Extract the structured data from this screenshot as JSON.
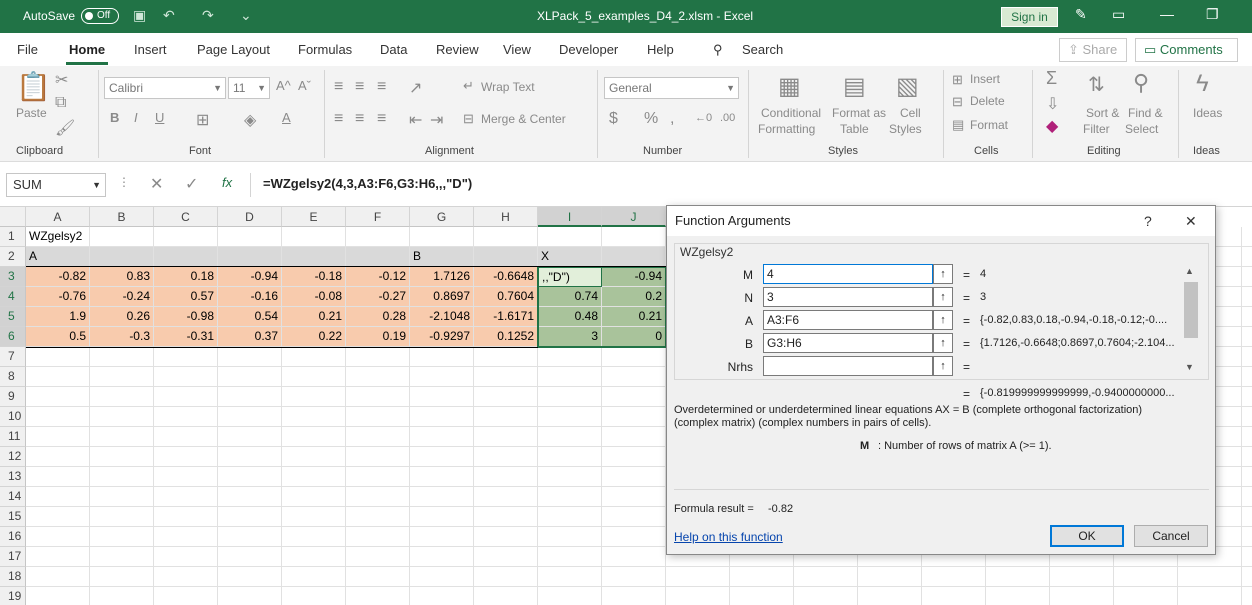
{
  "titlebar": {
    "autosave": "AutoSave",
    "toggle": "Off",
    "title": "XLPack_5_examples_D4_2.xlsm  -  Excel",
    "signin": "Sign in"
  },
  "menu": {
    "items": [
      "File",
      "Home",
      "Insert",
      "Page Layout",
      "Formulas",
      "Data",
      "Review",
      "View",
      "Developer",
      "Help"
    ],
    "search": "Search",
    "share": "Share",
    "comments": "Comments"
  },
  "ribbon": {
    "paste": "Paste",
    "font_name": "Calibri",
    "font_size": "11",
    "wrap_text": "Wrap Text",
    "merge_center": "Merge & Center",
    "number_format": "General",
    "cond_fmt1": "Conditional",
    "cond_fmt2": "Formatting",
    "fmt_table1": "Format as",
    "fmt_table2": "Table",
    "cell_styles1": "Cell",
    "cell_styles2": "Styles",
    "insert": "Insert",
    "delete": "Delete",
    "format": "Format",
    "sort1": "Sort &",
    "sort2": "Filter",
    "find1": "Find &",
    "find2": "Select",
    "ideas": "Ideas",
    "groups": {
      "clipboard": "Clipboard",
      "font": "Font",
      "alignment": "Alignment",
      "number": "Number",
      "styles": "Styles",
      "cells": "Cells",
      "editing": "Editing",
      "ideas": "Ideas"
    }
  },
  "formula_bar": {
    "name_box": "SUM",
    "formula": "=WZgelsy2(4,3,A3:F6,G3:H6,,,\"D\")"
  },
  "sheet": {
    "columns": [
      "A",
      "B",
      "C",
      "D",
      "E",
      "F",
      "G",
      "H",
      "I",
      "J"
    ],
    "rows": [
      "1",
      "2",
      "3",
      "4",
      "5",
      "6",
      "7",
      "8",
      "9",
      "10",
      "11",
      "12",
      "13",
      "14",
      "15",
      "16",
      "17",
      "18",
      "19"
    ],
    "a1": "WZgelsy2",
    "a2": "A",
    "g2": "B",
    "i2": "X",
    "i3": ",,\"D\")",
    "data": [
      [
        "-0.82",
        "0.83",
        "0.18",
        "-0.94",
        "-0.18",
        "-0.12",
        "1.7126",
        "-0.6648",
        "",
        "-0.94"
      ],
      [
        "-0.76",
        "-0.24",
        "0.57",
        "-0.16",
        "-0.08",
        "-0.27",
        "0.8697",
        "0.7604",
        "0.74",
        "0.2"
      ],
      [
        "1.9",
        "0.26",
        "-0.98",
        "0.54",
        "0.21",
        "0.28",
        "-2.1048",
        "-1.6171",
        "0.48",
        "0.21"
      ],
      [
        "0.5",
        "-0.3",
        "-0.31",
        "0.37",
        "0.22",
        "0.19",
        "-0.9297",
        "0.1252",
        "3",
        "0"
      ]
    ]
  },
  "dialog": {
    "title": "Function Arguments",
    "help_q": "?",
    "close": "✕",
    "function_name": "WZgelsy2",
    "args": [
      {
        "label": "M",
        "value": "4",
        "result": "4"
      },
      {
        "label": "N",
        "value": "3",
        "result": "3"
      },
      {
        "label": "A",
        "value": "A3:F6",
        "result": "{-0.82,0.83,0.18,-0.94,-0.18,-0.12;-0...."
      },
      {
        "label": "B",
        "value": "G3:H6",
        "result": "{1.7126,-0.6648;0.8697,0.7604;-2.104..."
      },
      {
        "label": "Nrhs",
        "value": "",
        "result": ""
      }
    ],
    "total_result": "{-0.819999999999999,-0.9400000000...",
    "desc1": "Overdetermined or underdetermined linear equations AX = B (complete orthogonal factorization)",
    "desc2": "(complex matrix) (complex numbers in pairs of cells).",
    "arg_help_name": "M",
    "arg_help_text": ": Number of rows of matrix A (>= 1).",
    "formula_result_label": "Formula result =",
    "formula_result_value": "-0.82",
    "help_link": "Help on this function",
    "ok": "OK",
    "cancel": "Cancel"
  }
}
